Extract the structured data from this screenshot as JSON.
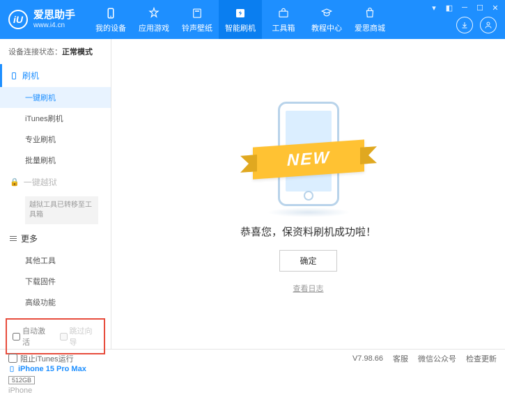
{
  "header": {
    "logo_letter": "iU",
    "app_name": "爱思助手",
    "site_url": "www.i4.cn",
    "nav": [
      {
        "label": "我的设备"
      },
      {
        "label": "应用游戏"
      },
      {
        "label": "铃声壁纸"
      },
      {
        "label": "智能刷机"
      },
      {
        "label": "工具箱"
      },
      {
        "label": "教程中心"
      },
      {
        "label": "爱思商城"
      }
    ]
  },
  "sidebar": {
    "status_label": "设备连接状态：",
    "status_value": "正常模式",
    "section_flash": "刷机",
    "items_flash": [
      "一键刷机",
      "iTunes刷机",
      "专业刷机",
      "批量刷机"
    ],
    "section_jailbreak": "一键越狱",
    "jailbreak_note": "越狱工具已转移至工具箱",
    "section_more": "更多",
    "items_more": [
      "其他工具",
      "下载固件",
      "高级功能"
    ],
    "options": {
      "auto_activate": "自动激活",
      "skip_guide": "跳过向导"
    },
    "device": {
      "name": "iPhone 15 Pro Max",
      "storage": "512GB",
      "type": "iPhone"
    }
  },
  "main": {
    "ribbon": "NEW",
    "success": "恭喜您，保资料刷机成功啦！",
    "ok": "确定",
    "view_log": "查看日志"
  },
  "footer": {
    "block_itunes": "阻止iTunes运行",
    "version": "V7.98.66",
    "links": [
      "客服",
      "微信公众号",
      "检查更新"
    ]
  }
}
